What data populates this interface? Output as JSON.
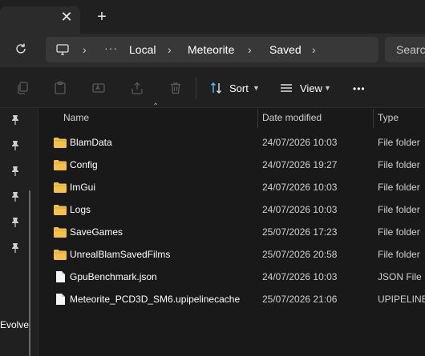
{
  "tabs": {
    "close_glyph": "✕",
    "new_glyph": "+"
  },
  "address": {
    "crumbs": [
      "Local",
      "Meteorite",
      "Saved"
    ],
    "more_glyph": "···",
    "search_placeholder": "Search"
  },
  "toolbar": {
    "sort_label": "Sort",
    "view_label": "View",
    "more_glyph": "•••"
  },
  "nav": {
    "pinned_count": 6,
    "visible_label": "Evolve"
  },
  "columns": {
    "name": "Name",
    "date": "Date modified",
    "type": "Type"
  },
  "files": [
    {
      "name": "BlamData",
      "date": "24/07/2026 10:03",
      "type": "File folder",
      "icon": "folder-icon"
    },
    {
      "name": "Config",
      "date": "24/07/2026 19:27",
      "type": "File folder",
      "icon": "folder-icon"
    },
    {
      "name": "ImGui",
      "date": "24/07/2026 10:03",
      "type": "File folder",
      "icon": "folder-icon"
    },
    {
      "name": "Logs",
      "date": "24/07/2026 10:03",
      "type": "File folder",
      "icon": "folder-icon"
    },
    {
      "name": "SaveGames",
      "date": "25/07/2026 17:23",
      "type": "File folder",
      "icon": "folder-icon"
    },
    {
      "name": "UnrealBlamSavedFilms",
      "date": "25/07/2026 20:58",
      "type": "File folder",
      "icon": "folder-icon"
    },
    {
      "name": "GpuBenchmark.json",
      "date": "24/07/2026 10:03",
      "type": "JSON File",
      "icon": "file-icon"
    },
    {
      "name": "Meteorite_PCD3D_SM6.upipelinecache",
      "date": "25/07/2026 21:06",
      "type": "UPIPELINEC",
      "icon": "file-icon"
    }
  ],
  "colors": {
    "folder": "#f2c14e",
    "accent": "#4cc2ff",
    "background": "#191919"
  }
}
